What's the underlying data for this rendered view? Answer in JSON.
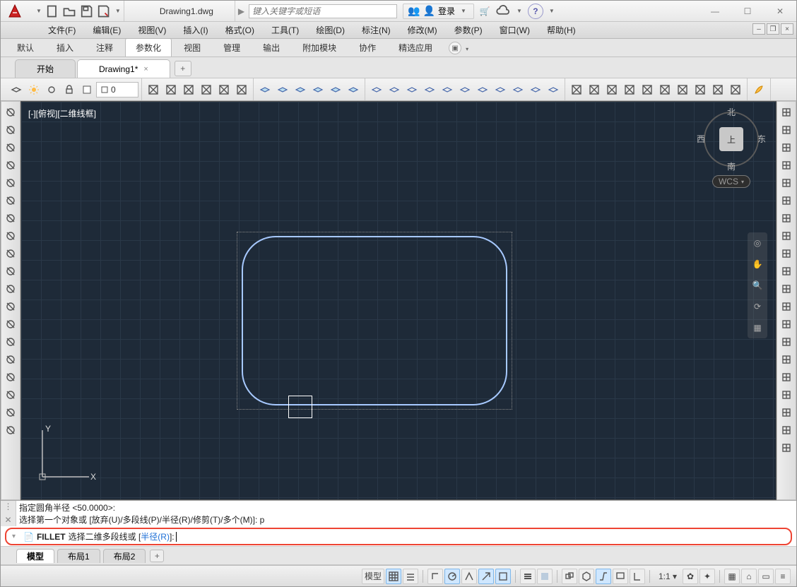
{
  "title_doc": "Drawing1.dwg",
  "search_placeholder": "键入关键字或短语",
  "login_label": "登录",
  "menus": [
    "文件(F)",
    "编辑(E)",
    "视图(V)",
    "插入(I)",
    "格式(O)",
    "工具(T)",
    "绘图(D)",
    "标注(N)",
    "修改(M)",
    "参数(P)",
    "窗口(W)",
    "帮助(H)"
  ],
  "ribbon_tabs": [
    "默认",
    "插入",
    "注释",
    "参数化",
    "视图",
    "管理",
    "输出",
    "附加模块",
    "协作",
    "精选应用"
  ],
  "ribbon_active_index": 3,
  "file_tabs": {
    "items": [
      "开始",
      "Drawing1*"
    ],
    "active_index": 1
  },
  "layer_current": "0",
  "viewport_label": "[-][俯视][二维线框]",
  "viewcube": {
    "n": "北",
    "s": "南",
    "e": "东",
    "w": "西",
    "face": "上",
    "wcs": "WCS"
  },
  "cmd_history": [
    "指定圆角半径 <50.0000>:",
    "选择第一个对象或 [放弃(U)/多段线(P)/半径(R)/修剪(T)/多个(M)]: p"
  ],
  "cmd_prompt": {
    "name": "FILLET",
    "pre": "选择二维多段线或 [",
    "opt": "半径(R)",
    "post": "]:"
  },
  "layout_tabs": {
    "items": [
      "模型",
      "布局1",
      "布局2"
    ],
    "active_index": 0
  },
  "statusbar_model": "模型",
  "scale": "1:1",
  "left_tools": [
    "line",
    "circle",
    "arc",
    "mirror",
    "offset",
    "array",
    "move",
    "rotate",
    "rect",
    "pline",
    "scissors",
    "trim",
    "copy",
    "paste",
    "fillet",
    "point",
    "spline",
    "hatch",
    "ellipse"
  ],
  "right_tools": [
    "panel",
    "orbit",
    "pan",
    "steer",
    "zoom",
    "3dorbit",
    "nav",
    "render",
    "section",
    "layout",
    "measure",
    "light",
    "camera",
    "mat",
    "walk",
    "lock",
    "props",
    "sheet",
    "clip",
    "arrow"
  ]
}
